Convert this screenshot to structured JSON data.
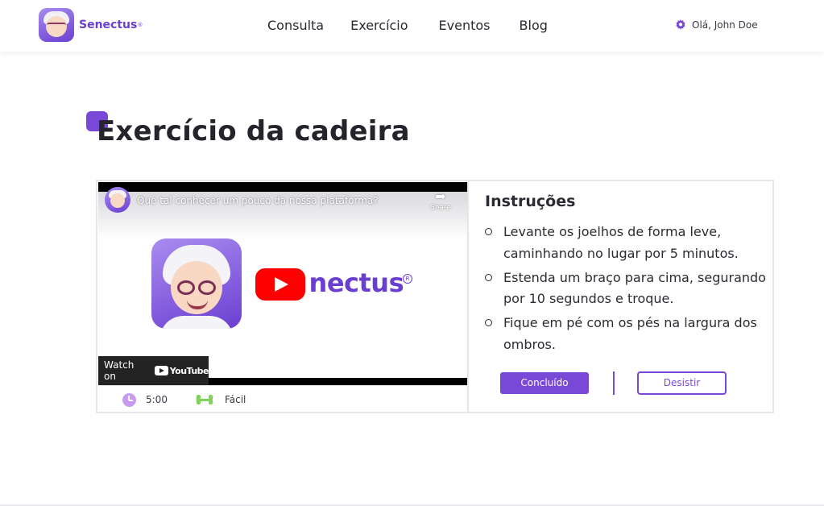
{
  "header": {
    "brand": "Senectus",
    "brand_reg": "®",
    "nav": [
      "Consulta",
      "Exercício",
      "Eventos",
      "Blog"
    ],
    "greeting": "Olá, John Doe",
    "settings_icon": "gear-icon"
  },
  "page": {
    "title": "Exercício da cadeira"
  },
  "video": {
    "title": "Que tal conhecer um pouco da nossa plataforma?",
    "share_label": "Share",
    "brand_prefix": "S",
    "brand_suffix": "nectus",
    "brand_reg": "R",
    "watch_label": "Watch on",
    "youtube_label": "YouTube",
    "play_icon": "play-icon"
  },
  "meta": {
    "duration": "5:00",
    "difficulty": "Fácil",
    "duration_icon": "clock-icon",
    "difficulty_icon": "dumbbell-icon"
  },
  "instructions": {
    "title": "Instruções",
    "steps": [
      "Levante os joelhos de forma leve, caminhando no lugar por 5 minutos.",
      "Estenda um braço para cima, segurando por 10 segundos e troque.",
      "Fique em pé com os pés na largura dos ombros."
    ]
  },
  "actions": {
    "done_label": "Concluído",
    "quit_label": "Desistir"
  },
  "colors": {
    "accent": "#7a48d6",
    "play_red": "#ff0000",
    "clock": "#c79bf2",
    "dumbbell": "#7fd35a"
  }
}
